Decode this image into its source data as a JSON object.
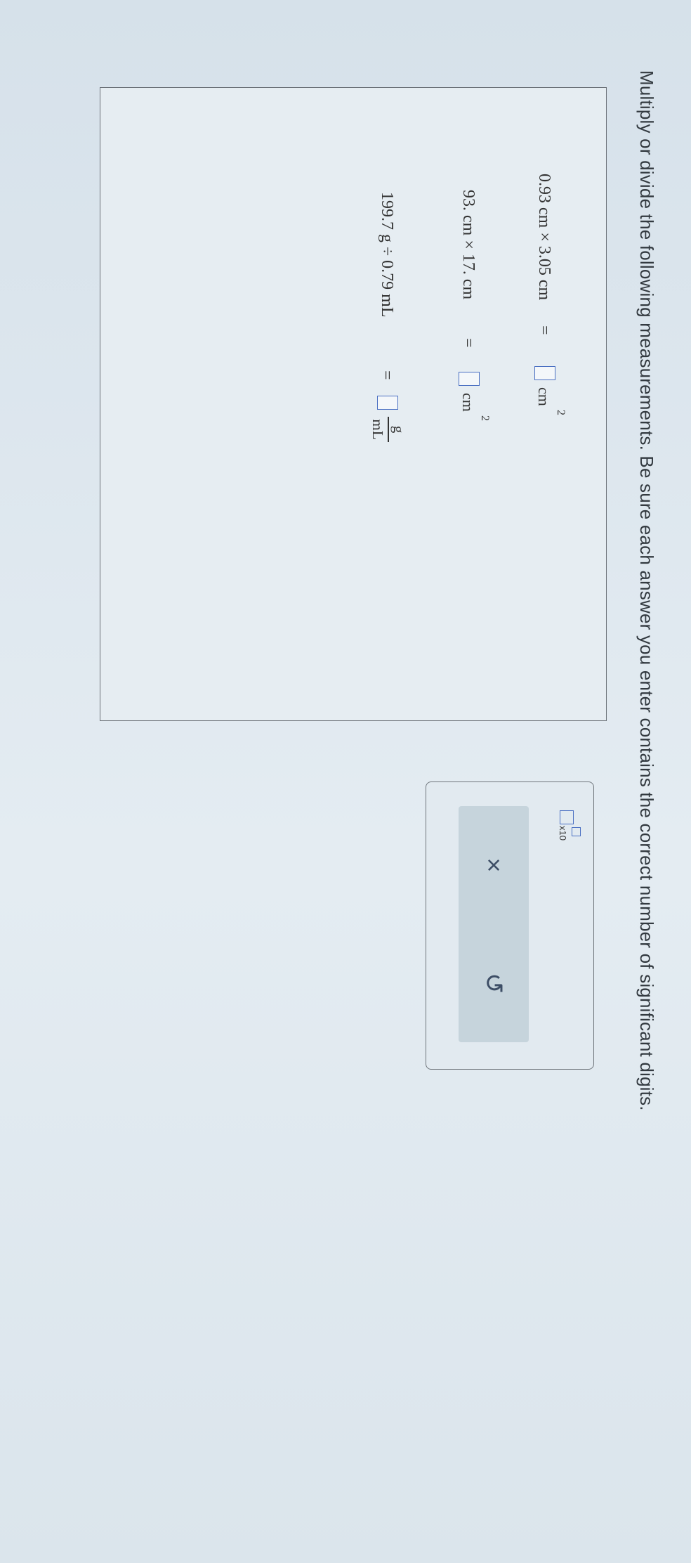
{
  "instruction": "Multiply or divide the following measurements. Be sure each answer you enter contains the correct number of significant digits.",
  "questions": [
    {
      "expression": "0.93 cm × 3.05 cm",
      "equals": "=",
      "unit": "cm",
      "exponent": "2"
    },
    {
      "expression": "93. cm × 17. cm",
      "equals": "=",
      "unit": "cm",
      "exponent": "2"
    },
    {
      "expression": "199.7 g ÷ 0.79 mL",
      "equals": "=",
      "unit_numerator": "g",
      "unit_denominator": "mL"
    }
  ],
  "tools": {
    "x10_label": "x10",
    "clear_symbol": "×",
    "undo_symbol": "↺"
  },
  "colors": {
    "answer_box_border": "#4a6fc2",
    "action_bar": "#c6d4dc"
  }
}
